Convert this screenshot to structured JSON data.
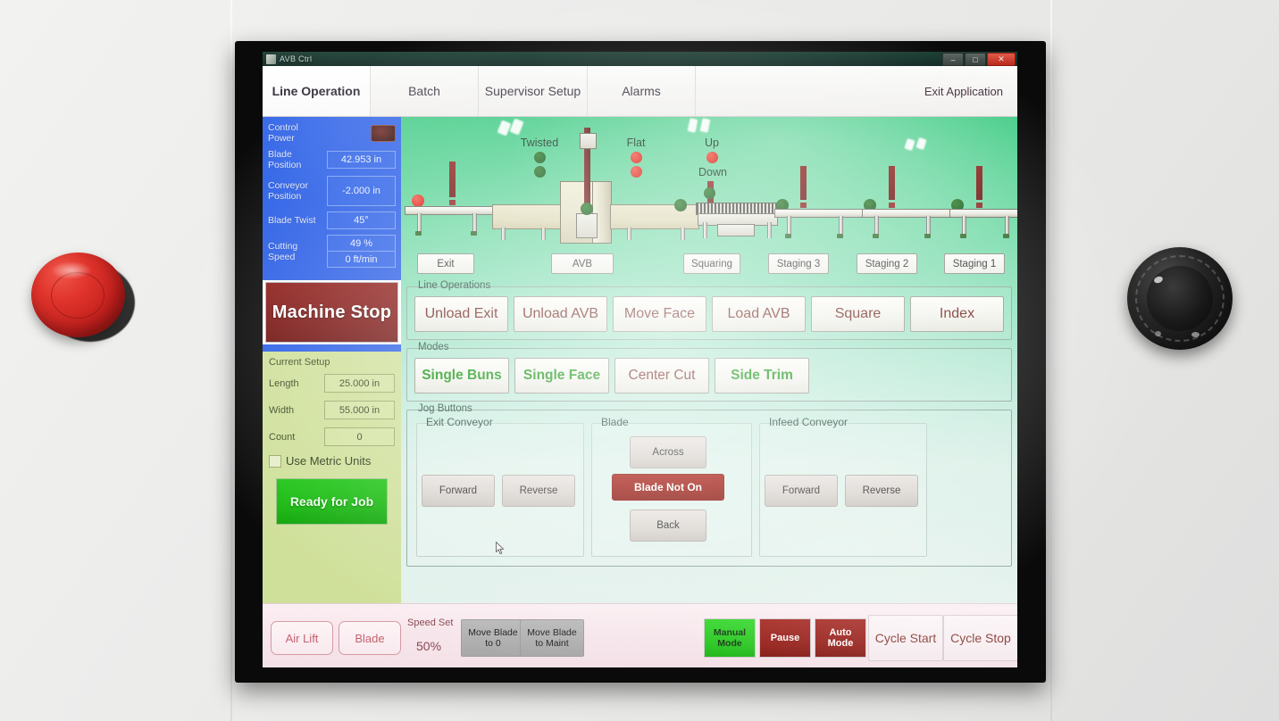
{
  "window": {
    "app_title": "AVB Ctrl",
    "minimize_label": "–",
    "maximize_label": "□",
    "close_label": "✕"
  },
  "tabs": [
    {
      "label": "Line Operation",
      "active": true
    },
    {
      "label": "Batch",
      "active": false
    },
    {
      "label": "Supervisor Setup",
      "active": false
    },
    {
      "label": "Alarms",
      "active": false
    }
  ],
  "exit_application_label": "Exit Application",
  "sidebar": {
    "control_power_label": "Control Power",
    "readouts": [
      {
        "label": "Blade Position",
        "value": "42.953 in"
      },
      {
        "label": "Conveyor Position",
        "value": "-2.000 in"
      },
      {
        "label": "Blade Twist",
        "value": "45°"
      }
    ],
    "cutting_speed_label": "Cutting Speed",
    "cutting_speed_percent": "49 %",
    "cutting_speed_rate": "0 ft/min",
    "machine_stop_label": "Machine Stop",
    "current_setup_title": "Current Setup",
    "setup_rows": [
      {
        "label": "Length",
        "value": "25.000 in"
      },
      {
        "label": "Width",
        "value": "55.000 in"
      },
      {
        "label": "Count",
        "value": "0"
      }
    ],
    "metric_checkbox_label": "Use Metric Units",
    "metric_checked": false,
    "ready_label": "Ready for Job"
  },
  "diagram": {
    "indicators": [
      {
        "label": "Twisted",
        "lamps": [
          "green",
          "green"
        ]
      },
      {
        "label": "Flat",
        "lamps": [
          "red",
          "red"
        ]
      },
      {
        "label": "Up",
        "lamps": [
          "red"
        ]
      },
      {
        "label": "Down",
        "lamps": [
          "green"
        ]
      }
    ],
    "stations": [
      {
        "label": "Exit"
      },
      {
        "label": "AVB"
      },
      {
        "label": "Squaring"
      },
      {
        "label": "Staging 3"
      },
      {
        "label": "Staging 2"
      },
      {
        "label": "Staging 1"
      }
    ]
  },
  "line_operations": {
    "group_label": "Line Operations",
    "buttons": [
      {
        "label": "Unload Exit"
      },
      {
        "label": "Unload AVB"
      },
      {
        "label": "Move Face"
      },
      {
        "label": "Load AVB"
      },
      {
        "label": "Square"
      },
      {
        "label": "Index"
      }
    ]
  },
  "modes": {
    "group_label": "Modes",
    "buttons": [
      {
        "label": "Single Buns",
        "state": "on"
      },
      {
        "label": "Single Face",
        "state": "on"
      },
      {
        "label": "Center Cut",
        "state": "off"
      },
      {
        "label": "Side Trim",
        "state": "on"
      }
    ]
  },
  "jog": {
    "group_label": "Jog Buttons",
    "exit_conveyor": {
      "label": "Exit Conveyor",
      "forward_label": "Forward",
      "reverse_label": "Reverse"
    },
    "blade": {
      "label": "Blade",
      "across_label": "Across",
      "status_label": "Blade Not On",
      "back_label": "Back"
    },
    "infeed_conveyor": {
      "label": "Infeed Conveyor",
      "forward_label": "Forward",
      "reverse_label": "Reverse"
    }
  },
  "bottom_bar": {
    "air_lift_label": "Air Lift",
    "blade_label": "Blade",
    "speed_set_label": "Speed Set",
    "speed_set_value": "50%",
    "move_blade_to_0_label": "Move Blade to 0",
    "move_blade_to_maint_label": "Move Blade to Maint",
    "manual_mode_label": "Manual Mode",
    "pause_label": "Pause",
    "auto_mode_label": "Auto Mode",
    "cycle_start_label": "Cycle Start",
    "cycle_stop_label": "Cycle Stop"
  },
  "hardware": {
    "emergency_stop_name": "emergency-stop-button",
    "selector_knob_name": "selector-knob"
  },
  "colors": {
    "status_blue": "#2a5ee6",
    "stop_red": "#8d1b17",
    "ready_green": "#17b80f",
    "setup_green": "#cfe09a",
    "alarm_red": "#a6180f",
    "mode_on_green": "#13930f",
    "mode_off_red": "#6b1f18"
  }
}
